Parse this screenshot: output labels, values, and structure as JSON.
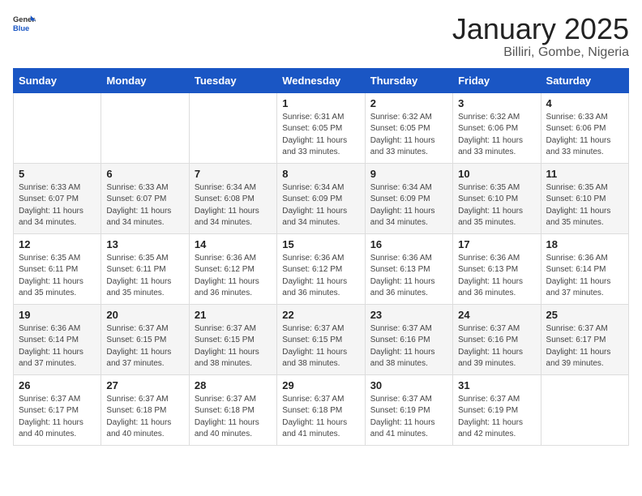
{
  "header": {
    "logo_general": "General",
    "logo_blue": "Blue",
    "title": "January 2025",
    "location": "Billiri, Gombe, Nigeria"
  },
  "weekdays": [
    "Sunday",
    "Monday",
    "Tuesday",
    "Wednesday",
    "Thursday",
    "Friday",
    "Saturday"
  ],
  "weeks": [
    [
      {
        "day": "",
        "info": ""
      },
      {
        "day": "",
        "info": ""
      },
      {
        "day": "",
        "info": ""
      },
      {
        "day": "1",
        "info": "Sunrise: 6:31 AM\nSunset: 6:05 PM\nDaylight: 11 hours and 33 minutes."
      },
      {
        "day": "2",
        "info": "Sunrise: 6:32 AM\nSunset: 6:05 PM\nDaylight: 11 hours and 33 minutes."
      },
      {
        "day": "3",
        "info": "Sunrise: 6:32 AM\nSunset: 6:06 PM\nDaylight: 11 hours and 33 minutes."
      },
      {
        "day": "4",
        "info": "Sunrise: 6:33 AM\nSunset: 6:06 PM\nDaylight: 11 hours and 33 minutes."
      }
    ],
    [
      {
        "day": "5",
        "info": "Sunrise: 6:33 AM\nSunset: 6:07 PM\nDaylight: 11 hours and 34 minutes."
      },
      {
        "day": "6",
        "info": "Sunrise: 6:33 AM\nSunset: 6:07 PM\nDaylight: 11 hours and 34 minutes."
      },
      {
        "day": "7",
        "info": "Sunrise: 6:34 AM\nSunset: 6:08 PM\nDaylight: 11 hours and 34 minutes."
      },
      {
        "day": "8",
        "info": "Sunrise: 6:34 AM\nSunset: 6:09 PM\nDaylight: 11 hours and 34 minutes."
      },
      {
        "day": "9",
        "info": "Sunrise: 6:34 AM\nSunset: 6:09 PM\nDaylight: 11 hours and 34 minutes."
      },
      {
        "day": "10",
        "info": "Sunrise: 6:35 AM\nSunset: 6:10 PM\nDaylight: 11 hours and 35 minutes."
      },
      {
        "day": "11",
        "info": "Sunrise: 6:35 AM\nSunset: 6:10 PM\nDaylight: 11 hours and 35 minutes."
      }
    ],
    [
      {
        "day": "12",
        "info": "Sunrise: 6:35 AM\nSunset: 6:11 PM\nDaylight: 11 hours and 35 minutes."
      },
      {
        "day": "13",
        "info": "Sunrise: 6:35 AM\nSunset: 6:11 PM\nDaylight: 11 hours and 35 minutes."
      },
      {
        "day": "14",
        "info": "Sunrise: 6:36 AM\nSunset: 6:12 PM\nDaylight: 11 hours and 36 minutes."
      },
      {
        "day": "15",
        "info": "Sunrise: 6:36 AM\nSunset: 6:12 PM\nDaylight: 11 hours and 36 minutes."
      },
      {
        "day": "16",
        "info": "Sunrise: 6:36 AM\nSunset: 6:13 PM\nDaylight: 11 hours and 36 minutes."
      },
      {
        "day": "17",
        "info": "Sunrise: 6:36 AM\nSunset: 6:13 PM\nDaylight: 11 hours and 36 minutes."
      },
      {
        "day": "18",
        "info": "Sunrise: 6:36 AM\nSunset: 6:14 PM\nDaylight: 11 hours and 37 minutes."
      }
    ],
    [
      {
        "day": "19",
        "info": "Sunrise: 6:36 AM\nSunset: 6:14 PM\nDaylight: 11 hours and 37 minutes."
      },
      {
        "day": "20",
        "info": "Sunrise: 6:37 AM\nSunset: 6:15 PM\nDaylight: 11 hours and 37 minutes."
      },
      {
        "day": "21",
        "info": "Sunrise: 6:37 AM\nSunset: 6:15 PM\nDaylight: 11 hours and 38 minutes."
      },
      {
        "day": "22",
        "info": "Sunrise: 6:37 AM\nSunset: 6:15 PM\nDaylight: 11 hours and 38 minutes."
      },
      {
        "day": "23",
        "info": "Sunrise: 6:37 AM\nSunset: 6:16 PM\nDaylight: 11 hours and 38 minutes."
      },
      {
        "day": "24",
        "info": "Sunrise: 6:37 AM\nSunset: 6:16 PM\nDaylight: 11 hours and 39 minutes."
      },
      {
        "day": "25",
        "info": "Sunrise: 6:37 AM\nSunset: 6:17 PM\nDaylight: 11 hours and 39 minutes."
      }
    ],
    [
      {
        "day": "26",
        "info": "Sunrise: 6:37 AM\nSunset: 6:17 PM\nDaylight: 11 hours and 40 minutes."
      },
      {
        "day": "27",
        "info": "Sunrise: 6:37 AM\nSunset: 6:18 PM\nDaylight: 11 hours and 40 minutes."
      },
      {
        "day": "28",
        "info": "Sunrise: 6:37 AM\nSunset: 6:18 PM\nDaylight: 11 hours and 40 minutes."
      },
      {
        "day": "29",
        "info": "Sunrise: 6:37 AM\nSunset: 6:18 PM\nDaylight: 11 hours and 41 minutes."
      },
      {
        "day": "30",
        "info": "Sunrise: 6:37 AM\nSunset: 6:19 PM\nDaylight: 11 hours and 41 minutes."
      },
      {
        "day": "31",
        "info": "Sunrise: 6:37 AM\nSunset: 6:19 PM\nDaylight: 11 hours and 42 minutes."
      },
      {
        "day": "",
        "info": ""
      }
    ]
  ]
}
